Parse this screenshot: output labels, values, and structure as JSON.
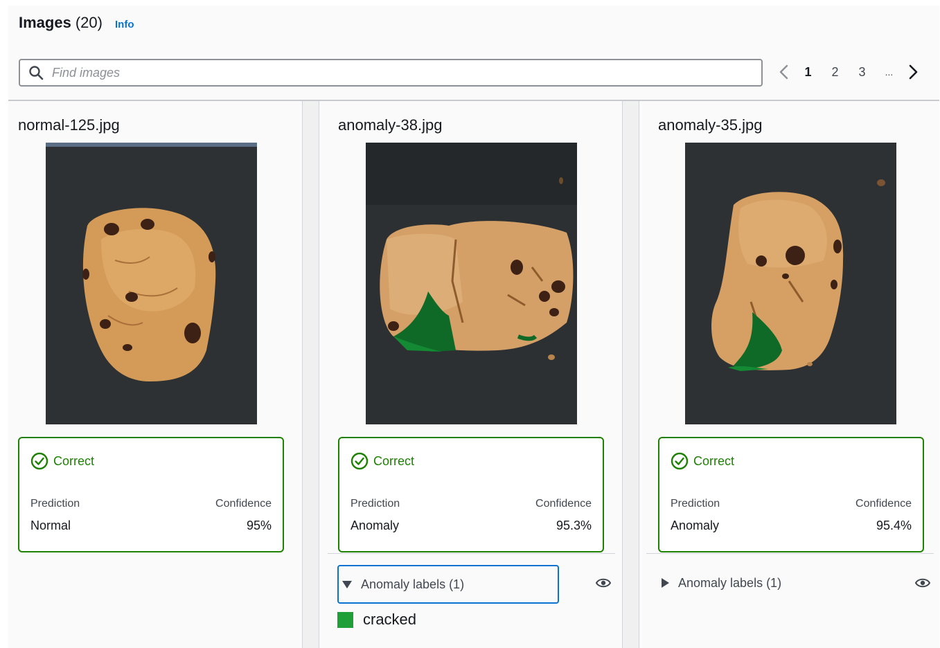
{
  "header": {
    "title": "Images",
    "count": "(20)",
    "info_label": "Info"
  },
  "search": {
    "placeholder": "Find images",
    "icon": "search-icon"
  },
  "pagination": {
    "pages": [
      "1",
      "2",
      "3"
    ],
    "ellipsis": "...",
    "current": "1",
    "prev_icon": "chevron-left-icon",
    "next_icon": "chevron-right-icon"
  },
  "cards": [
    {
      "filename": "normal-125.jpg",
      "status": "Correct",
      "prediction_label": "Prediction",
      "confidence_label": "Confidence",
      "prediction": "Normal",
      "confidence": "95%"
    },
    {
      "filename": "anomaly-38.jpg",
      "status": "Correct",
      "prediction_label": "Prediction",
      "confidence_label": "Confidence",
      "prediction": "Anomaly",
      "confidence": "95.3%",
      "anomaly_labels_title": "Anomaly labels (1)",
      "expanded": true,
      "labels": [
        {
          "name": "cracked",
          "color": "#1e9f38"
        }
      ]
    },
    {
      "filename": "anomaly-35.jpg",
      "status": "Correct",
      "prediction_label": "Prediction",
      "confidence_label": "Confidence",
      "prediction": "Anomaly",
      "confidence": "95.4%",
      "anomaly_labels_title": "Anomaly labels (1)",
      "expanded": false
    }
  ],
  "colors": {
    "success": "#1d8102",
    "link": "#0972d3",
    "anomaly_mask": "#0f7a2a"
  }
}
